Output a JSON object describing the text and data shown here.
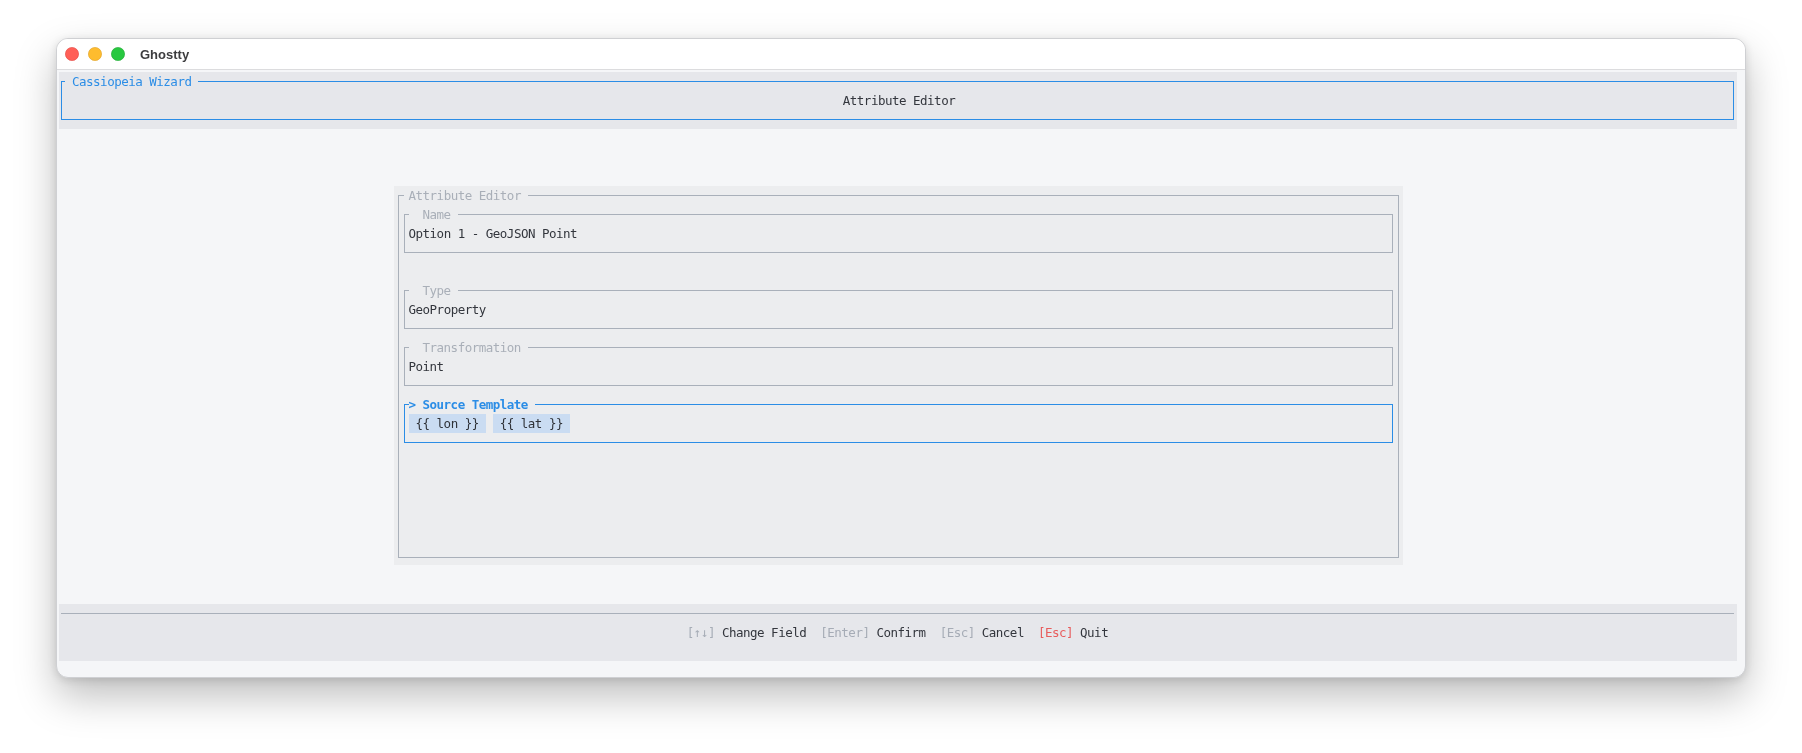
{
  "window": {
    "title": "Ghostty"
  },
  "header": {
    "app_name": "Cassiopeia Wizard",
    "title": "Attribute Editor"
  },
  "editor": {
    "title": "Attribute Editor",
    "cursor": ">",
    "fields": [
      {
        "kind": "text",
        "label": "Name",
        "value": "Option 1 - GeoJSON Point",
        "selected": false
      },
      {
        "kind": "text",
        "label": "Type",
        "value": "GeoProperty",
        "selected": false
      },
      {
        "kind": "text",
        "label": "Transformation",
        "value": "Point",
        "selected": false
      },
      {
        "kind": "tokens",
        "label": "Source Template",
        "tokens": [
          "{{ lon }}",
          "{{ lat }}"
        ],
        "selected": true
      }
    ]
  },
  "footer": {
    "hints": [
      {
        "key": "[↑↓]",
        "action": "Change Field",
        "color": "#a6acb6"
      },
      {
        "key": "[Enter]",
        "action": "Confirm",
        "color": "#a6acb6"
      },
      {
        "key": "[Esc]",
        "action": "Cancel",
        "color": "#a6acb6"
      },
      {
        "key": "[Esc]",
        "action": "Quit",
        "color": "#e85c5c"
      }
    ]
  }
}
